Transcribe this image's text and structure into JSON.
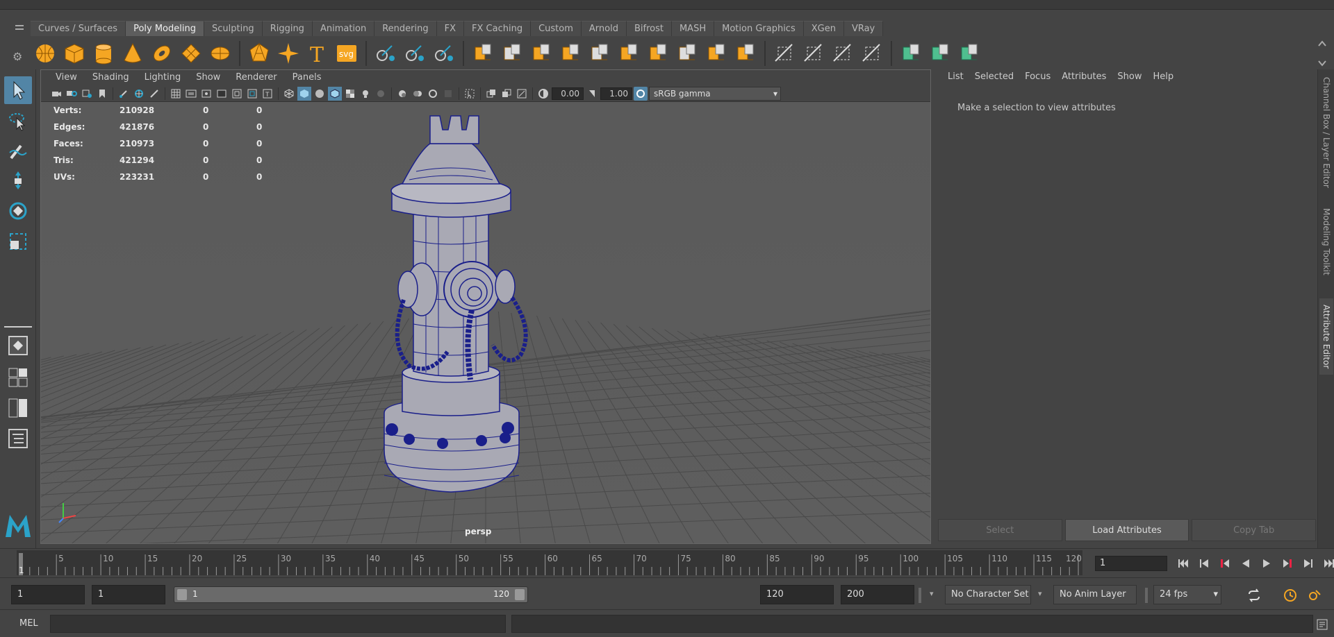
{
  "shelf": {
    "tabs": [
      "Curves / Surfaces",
      "Poly Modeling",
      "Sculpting",
      "Rigging",
      "Animation",
      "Rendering",
      "FX",
      "FX Caching",
      "Custom",
      "Arnold",
      "Bifrost",
      "MASH",
      "Motion Graphics",
      "XGen",
      "VRay"
    ],
    "active_tab": "Poly Modeling",
    "icons": [
      "poly-sphere-icon",
      "poly-cube-icon",
      "poly-cylinder-icon",
      "poly-cone-icon",
      "poly-torus-icon",
      "poly-plane-icon",
      "poly-disc-icon",
      "platonic-solid-icon",
      "super-shape-icon",
      "type-text-icon",
      "svg-icon",
      "combine-icon",
      "separate-icon",
      "smooth-icon",
      "booleans-icon",
      "extract-icon",
      "mirror-icon",
      "bridge-icon",
      "extrude-icon",
      "bevel-icon",
      "fill-hole-icon",
      "append-icon",
      "poke-icon",
      "wedge-icon",
      "insert-edge-loop-icon",
      "multi-cut-icon",
      "target-weld-icon",
      "snap-uv-icon",
      "map-uv-icon",
      "unfold-uv-icon",
      "uv-editor-icon"
    ],
    "text_icon": "T",
    "svg_icon_text": "svg"
  },
  "viewport": {
    "menu": [
      "View",
      "Shading",
      "Lighting",
      "Show",
      "Renderer",
      "Panels"
    ],
    "exposure": "0.00",
    "gamma": "1.00",
    "color_space": "sRGB gamma",
    "camera": "persp",
    "hud": [
      {
        "label": "Verts:",
        "value": "210928",
        "sel": "0",
        "tri": "0"
      },
      {
        "label": "Edges:",
        "value": "421876",
        "sel": "0",
        "tri": "0"
      },
      {
        "label": "Faces:",
        "value": "210973",
        "sel": "0",
        "tri": "0"
      },
      {
        "label": "Tris:",
        "value": "421294",
        "sel": "0",
        "tri": "0"
      },
      {
        "label": "UVs:",
        "value": "223231",
        "sel": "0",
        "tri": "0"
      }
    ],
    "wire_color": "#1a1f8a",
    "mesh_color": "#a9a9b4"
  },
  "attribute_editor": {
    "menu": [
      "List",
      "Selected",
      "Focus",
      "Attributes",
      "Show",
      "Help"
    ],
    "message": "Make a selection to view attributes",
    "buttons": [
      {
        "label": "Select",
        "enabled": false
      },
      {
        "label": "Load Attributes",
        "enabled": true
      },
      {
        "label": "Copy Tab",
        "enabled": false
      }
    ]
  },
  "side_tabs": [
    "Channel Box / Layer Editor",
    "Modeling Toolkit",
    "Attribute Editor"
  ],
  "active_side_tab": "Attribute Editor",
  "timeline": {
    "ticks": [
      "5",
      "10",
      "15",
      "20",
      "25",
      "30",
      "35",
      "40",
      "45",
      "50",
      "55",
      "60",
      "65",
      "70",
      "75",
      "80",
      "85",
      "90",
      "95",
      "100",
      "105",
      "110",
      "115",
      "120"
    ],
    "start_marker": "1",
    "current_frame": "1"
  },
  "range": {
    "start": "1",
    "anim_start": "1",
    "slider_start": "1",
    "slider_end": "120",
    "playback_end": "120",
    "anim_end": "200",
    "character_set": "No Character Set",
    "anim_layer": "No Anim Layer",
    "fps": "24 fps"
  },
  "command_line": {
    "label": "MEL"
  },
  "colors": {
    "accent": "#5285a6",
    "shelf_orange": "#f5a623",
    "shelf_green": "#4fbf8f",
    "maya_logo": "#2ba3c9"
  }
}
